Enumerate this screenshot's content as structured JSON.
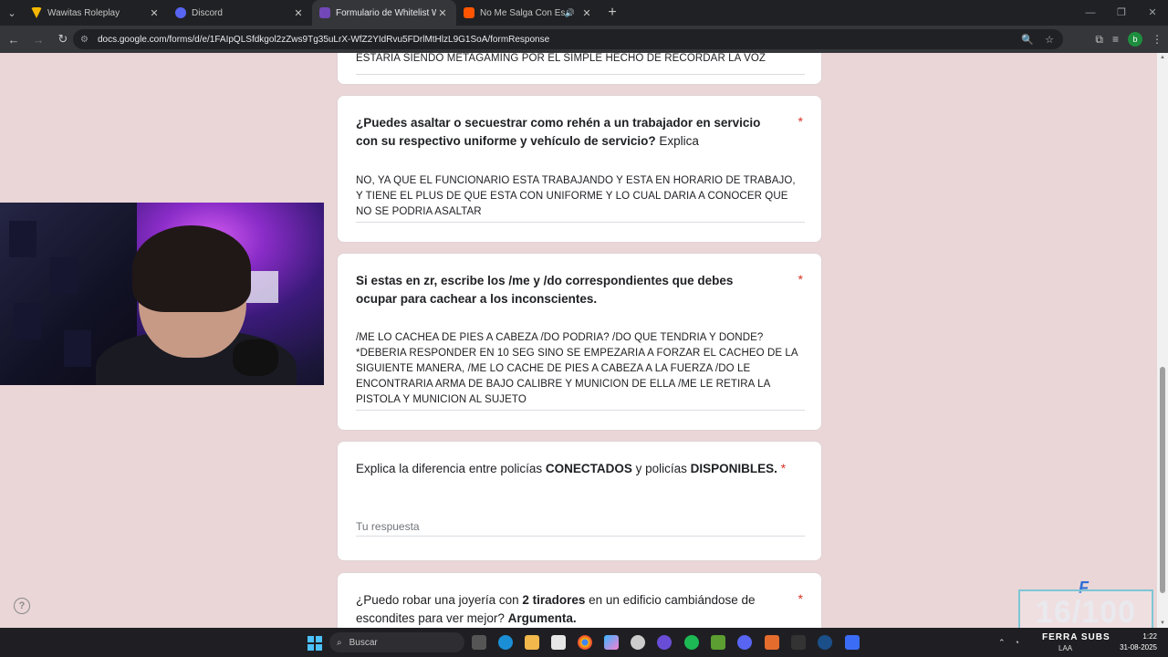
{
  "tabs": [
    {
      "title": "Wawitas Roleplay",
      "color": "#f5b800"
    },
    {
      "title": "Discord",
      "color": "#5865f2"
    },
    {
      "title": "Formulario de Whitelist WAWITAS",
      "color": "#7248b9"
    },
    {
      "title": "No Me Salga Con Esa | Cris",
      "color": "#ff5500"
    }
  ],
  "address": {
    "url": "docs.google.com/forms/d/e/1FAIpQLSfdkgol2zZws9Tg35uLrX-WfZ2YIdRvu5FDrlMtHlzL9G1SoA/formResponse"
  },
  "form": {
    "partial_answer": "ESTARIA SIENDO METAGAMING POR EL SIMPLE HECHO DE RECORDAR LA VOZ",
    "q1": {
      "title_bold": "¿Puedes asaltar o secuestrar como rehén a un trabajador en servicio con su respectivo uniforme y vehículo de servicio?",
      "title_rest": " Explica",
      "answer": "NO, YA QUE EL FUNCIONARIO ESTA TRABAJANDO Y ESTA EN HORARIO DE TRABAJO, Y TIENE EL PLUS DE QUE ESTA CON UNIFORME Y LO CUAL DARIA A CONOCER QUE NO SE PODRIA ASALTAR"
    },
    "q2": {
      "title_bold": "Si estas en zr, escribe los /me y /do correspondientes que debes ocupar para cachear a los inconscientes.",
      "answer": "/ME LO CACHEA DE PIES A CABEZA /DO PODRIA? /DO QUE TENDRIA Y DONDE? *DEBERIA RESPONDER EN 10 SEG SINO SE EMPEZARIA A FORZAR EL CACHEO DE LA SIGUIENTE MANERA, /ME LO CACHE DE PIES A CABEZA A LA FUERZA /DO LE ENCONTRARIA ARMA DE BAJO CALIBRE Y MUNICION DE  ELLA /ME LE RETIRA LA PISTOLA Y MUNICION AL SUJETO"
    },
    "q3": {
      "t1": "Explica la diferencia entre policías ",
      "t2": "CONECTADOS",
      "t3": " y policías ",
      "t4": "DISPONIBLES.",
      "placeholder": "Tu respuesta"
    },
    "q4": {
      "t1": "¿Puedo robar una joyería con ",
      "t2": "2 tiradores",
      "t3": " en un edificio cambiándose de escondites para ver mejor? ",
      "t4": "Argumenta."
    },
    "required_mark": "*"
  },
  "overlay": {
    "sub_count": "16/100",
    "brand": "FERRA SUBS",
    "logo_letter": "F"
  },
  "taskbar": {
    "search_placeholder": "Buscar",
    "lang": "LAA",
    "time": "1:22",
    "date": "31-08-2025"
  }
}
